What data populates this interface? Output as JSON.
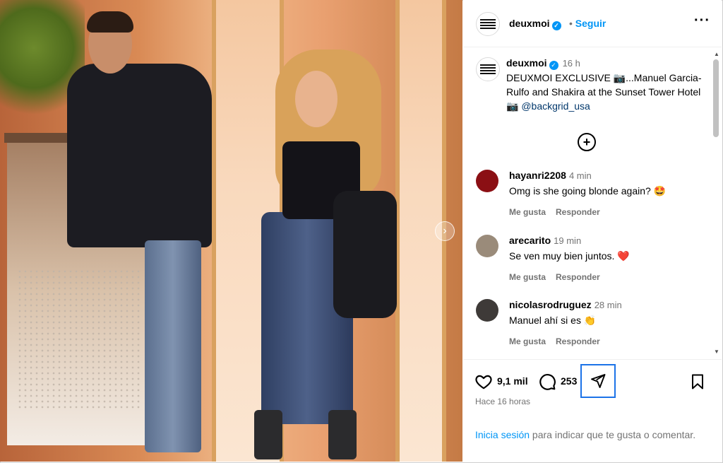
{
  "header": {
    "username": "deuxmoi",
    "follow_label": "Seguir",
    "separator": "•",
    "more_icon": "ellipsis-icon"
  },
  "caption": {
    "username": "deuxmoi",
    "time": "16 h",
    "text_before": "DEUXMOI EXCLUSIVE 📷...Manuel Garcia-Rulfo and Shakira at the Sunset Tower Hotel 📷 ",
    "mention": "@backgrid_usa"
  },
  "load_more_icon": "plus-circle-icon",
  "comments": [
    {
      "username": "hayanri2208",
      "time": "4 min",
      "text": "Omg is she going blonde again? 🤩",
      "like_label": "Me gusta",
      "reply_label": "Responder",
      "avatar_color": "#8b0f14"
    },
    {
      "username": "arecarito",
      "time": "19 min",
      "text": "Se ven muy bien juntos. ❤️",
      "like_label": "Me gusta",
      "reply_label": "Responder",
      "avatar_color": "#9a8b7a"
    },
    {
      "username": "nicolasrodruguez",
      "time": "28 min",
      "text": "Manuel ahí si es 👏",
      "like_label": "Me gusta",
      "reply_label": "Responder",
      "avatar_color": "#3e3a38"
    }
  ],
  "actions": {
    "likes": "9,1 mil",
    "comments": "253",
    "posted": "Hace 16 horas"
  },
  "login": {
    "link": "Inicia sesión",
    "rest": " para indicar que te gusta o comentar."
  },
  "colors": {
    "accent": "#0095f6",
    "focus_outline": "#1c73e8"
  }
}
